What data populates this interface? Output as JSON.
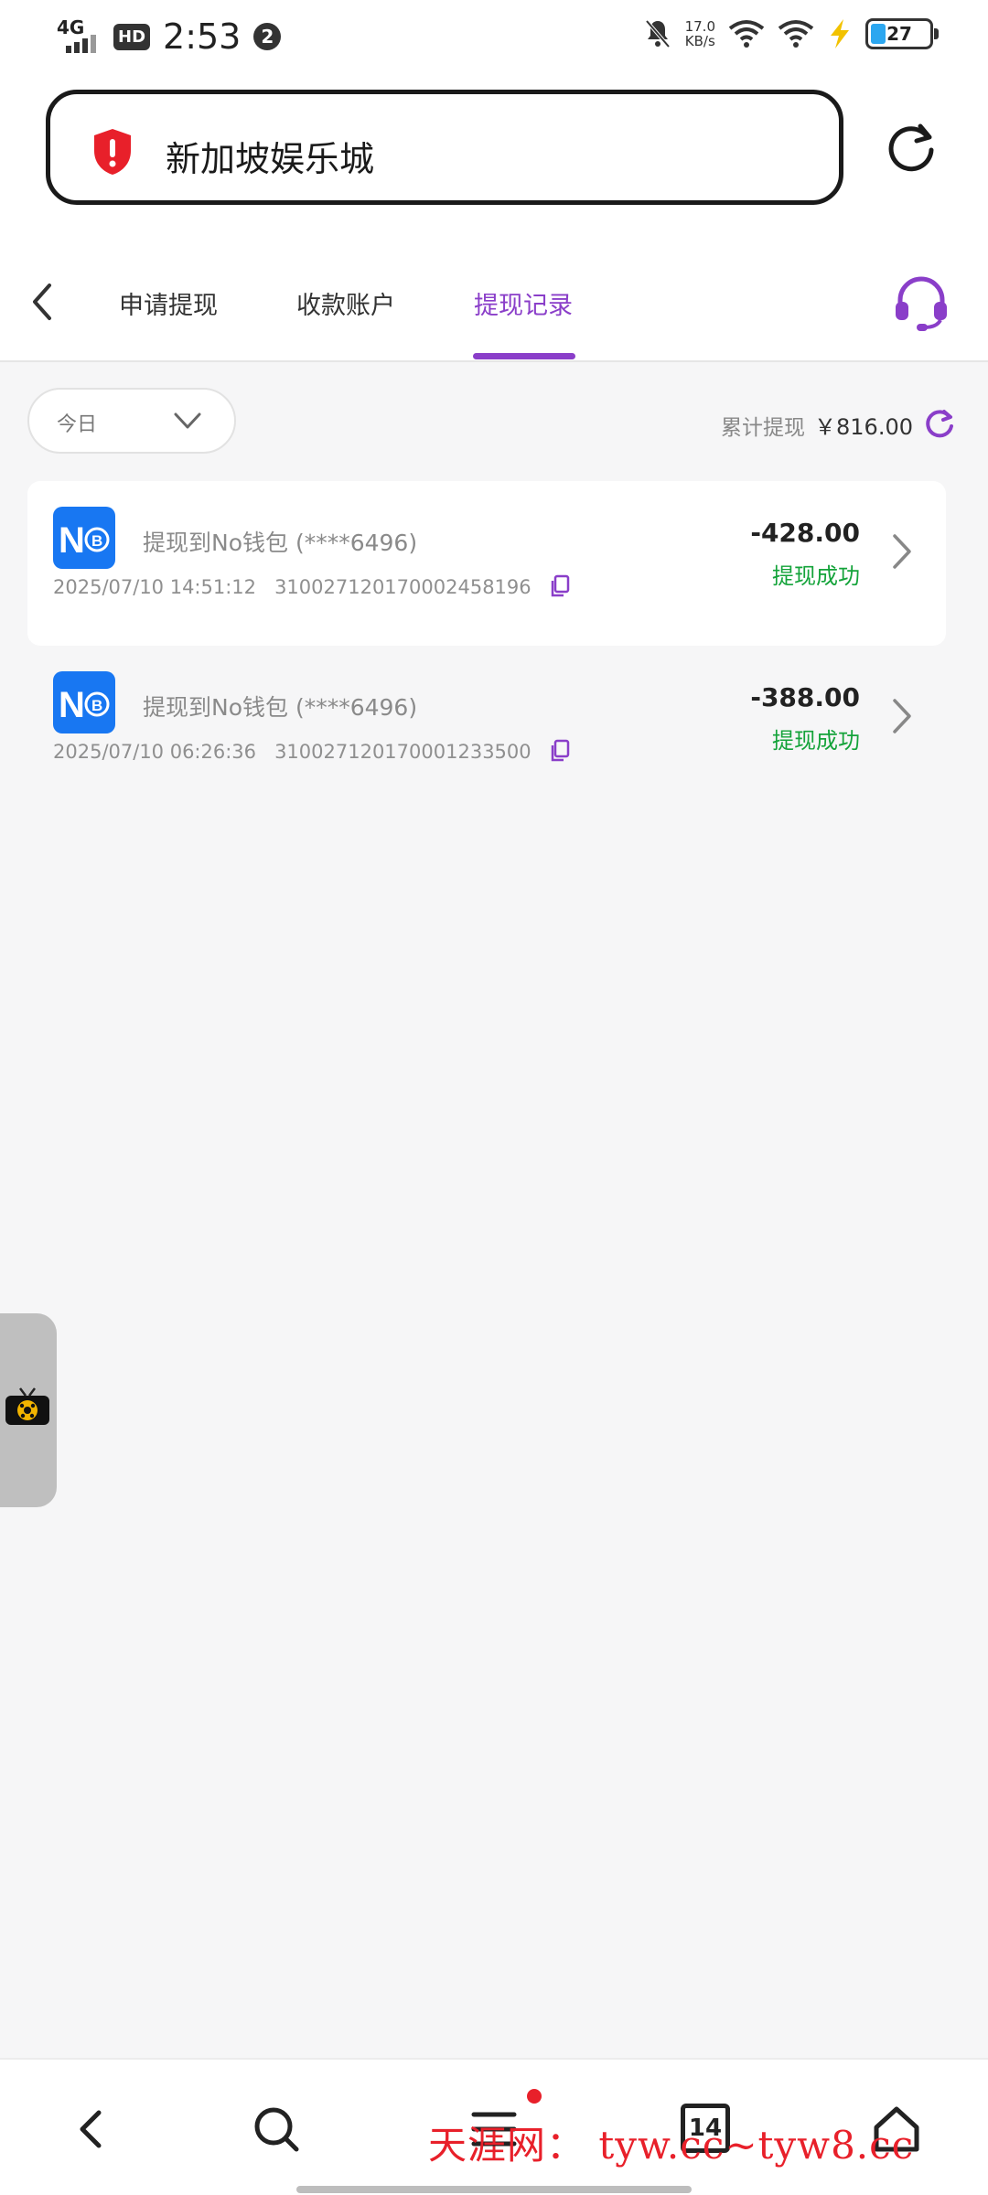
{
  "status_bar": {
    "network": "4G",
    "hd": "HD",
    "time": "2:53",
    "notification_count": "2",
    "speed_value": "17.0",
    "speed_unit": "KB/s",
    "battery": "27"
  },
  "address_bar": {
    "title": "新加坡娱乐城"
  },
  "tabs": [
    {
      "label": "申请提现"
    },
    {
      "label": "收款账户"
    },
    {
      "label": "提现记录"
    }
  ],
  "filter": {
    "selected": "今日",
    "total_label": "累计提现",
    "total_amount": "￥816.00"
  },
  "records": [
    {
      "logo_text": "N",
      "title": "提现到No钱包 (****6496)",
      "datetime": "2025/07/10 14:51:12",
      "order_no": "310027120170002458196",
      "amount": "-428.00",
      "status": "提现成功"
    },
    {
      "logo_text": "N",
      "title": "提现到No钱包 (****6496)",
      "datetime": "2025/07/10 06:26:36",
      "order_no": "310027120170001233500",
      "amount": "-388.00",
      "status": "提现成功"
    }
  ],
  "bottom_nav": {
    "tabs_count": "14",
    "watermark": "天涯网： tyw.cc~tyw8.cc"
  },
  "colors": {
    "accent": "#8a3ec9",
    "success": "#14a33a",
    "wallet_blue": "#1877f2",
    "alert_red": "#e8202a"
  }
}
